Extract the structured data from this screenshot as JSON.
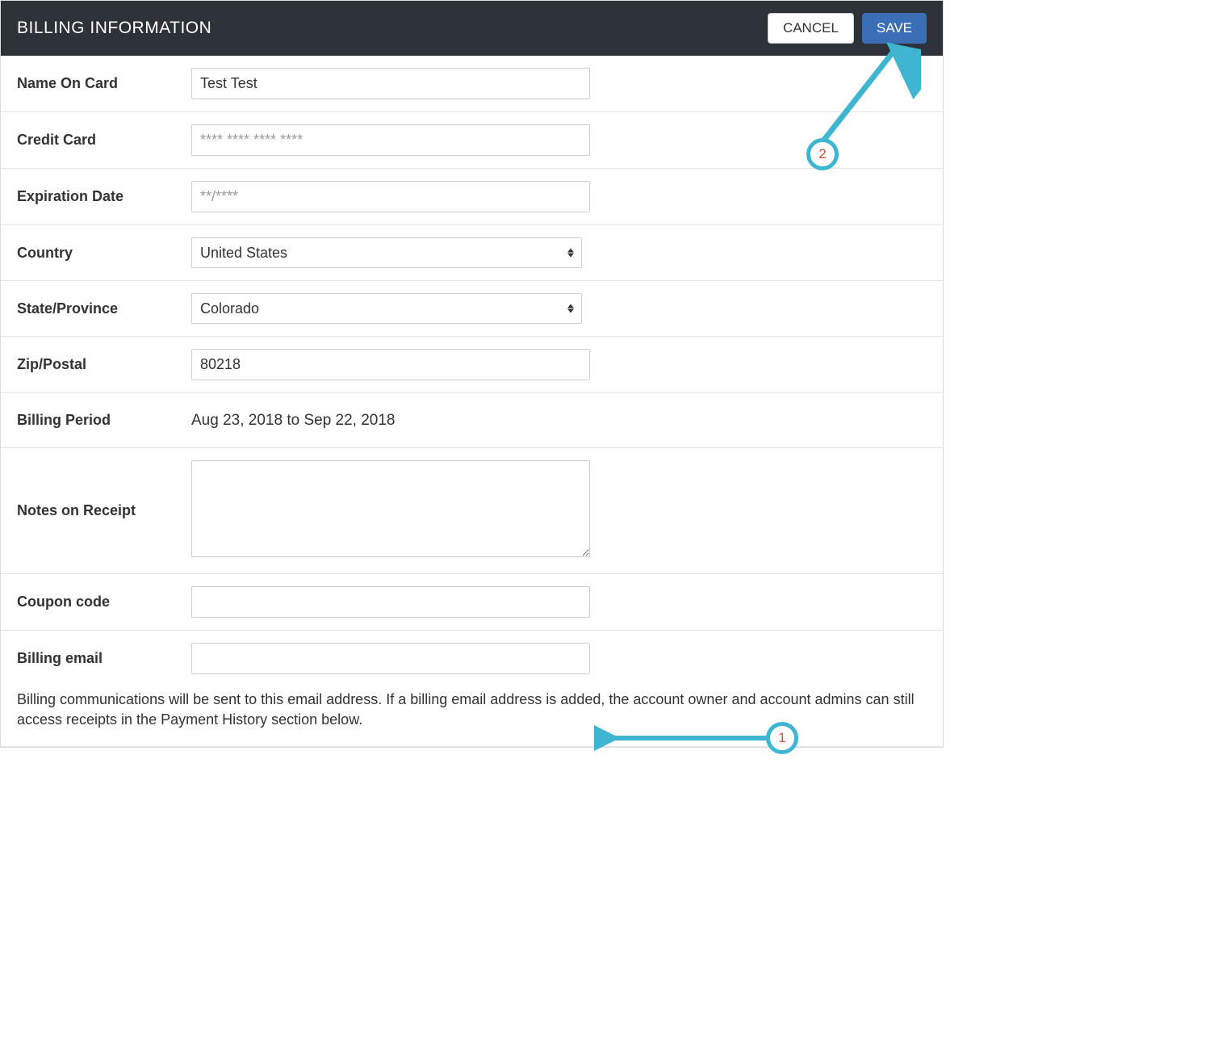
{
  "header": {
    "title": "BILLING INFORMATION",
    "cancel_label": "CANCEL",
    "save_label": "SAVE"
  },
  "fields": {
    "name_on_card": {
      "label": "Name On Card",
      "value": "Test Test"
    },
    "credit_card": {
      "label": "Credit Card",
      "placeholder": "**** **** **** ****",
      "value": ""
    },
    "expiration_date": {
      "label": "Expiration Date",
      "placeholder": "**/****",
      "value": ""
    },
    "country": {
      "label": "Country",
      "selected": "United States"
    },
    "state_province": {
      "label": "State/Province",
      "selected": "Colorado"
    },
    "zip_postal": {
      "label": "Zip/Postal",
      "value": "80218"
    },
    "billing_period": {
      "label": "Billing Period",
      "value": "Aug 23, 2018 to Sep 22, 2018"
    },
    "notes_on_receipt": {
      "label": "Notes on Receipt",
      "value": ""
    },
    "coupon_code": {
      "label": "Coupon code",
      "value": ""
    },
    "billing_email": {
      "label": "Billing email",
      "value": ""
    }
  },
  "help": {
    "billing_email": "Billing communications will be sent to this email address. If a billing email address is added, the account owner and account admins can still access receipts in the Payment History section below."
  },
  "annotations": {
    "marker1": "1",
    "marker2": "2"
  }
}
